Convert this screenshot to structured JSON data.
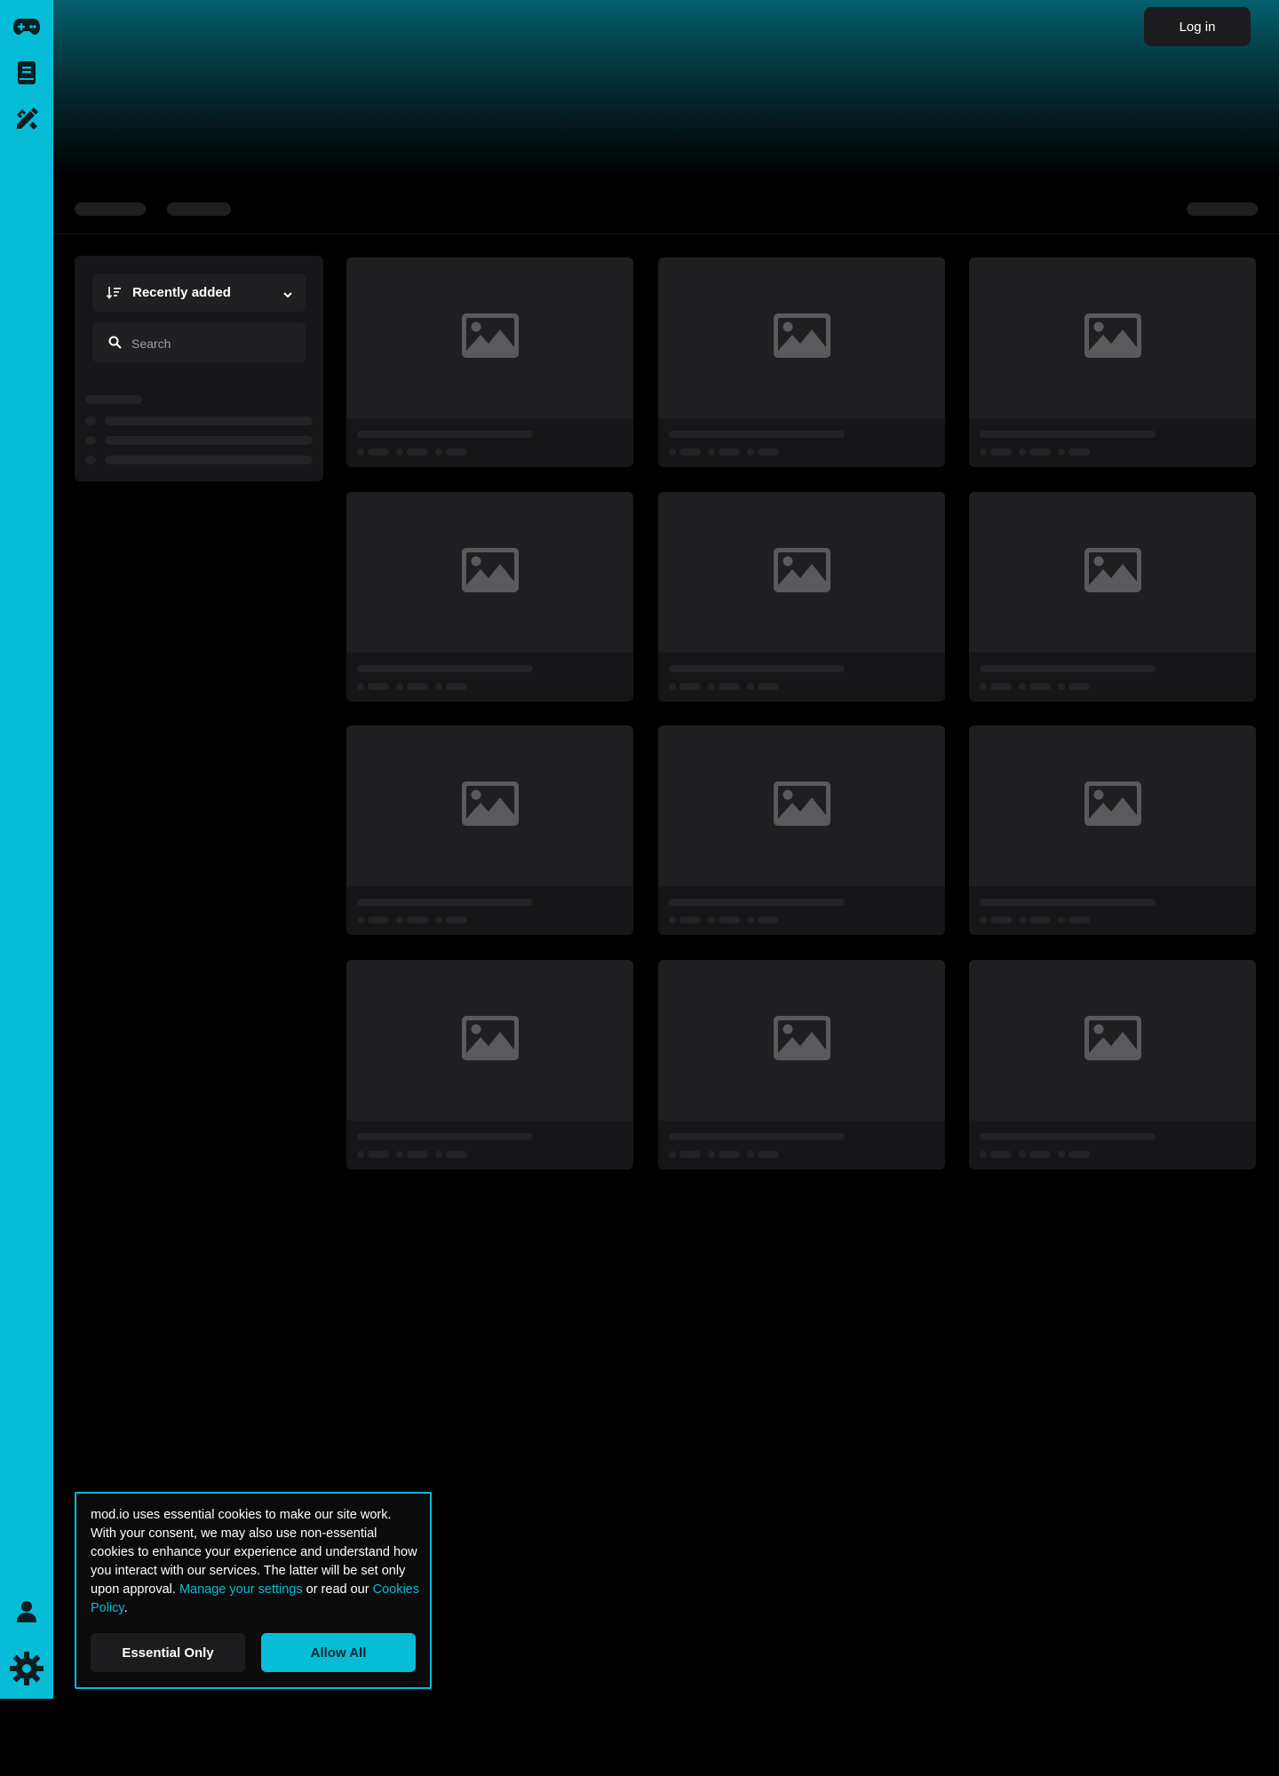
{
  "header": {
    "login_label": "Log in"
  },
  "sidebar": {
    "top_icons": [
      "gamepad-icon",
      "book-icon",
      "tools-icon"
    ],
    "bottom_icons": [
      "user-icon",
      "settings-gear-icon"
    ]
  },
  "filters": {
    "sort_label": "Recently added",
    "search_placeholder": "Search"
  },
  "cookie_banner": {
    "message": "mod.io uses essential cookies to make our site work. With your consent, we may also use non-essential cookies to enhance your experience and understand how you interact with our services. The latter will be set only upon approval. ",
    "manage_link": "Manage your settings",
    "middle_text": " or read our ",
    "policy_link": "Cookies Policy",
    "end_text": ".",
    "essential_label": "Essential Only",
    "allow_label": "Allow All"
  },
  "colors": {
    "accent": "#06bcd6",
    "background": "#000000",
    "panel": "#161618",
    "placeholder": "#1f1f21"
  }
}
